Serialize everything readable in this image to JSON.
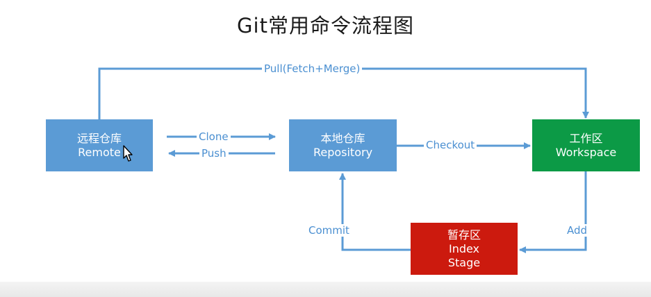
{
  "title": "Git常用命令流程图",
  "nodes": {
    "remote": {
      "line1": "远程仓库",
      "line2": "Remote",
      "color": "#5b9bd5"
    },
    "repository": {
      "line1": "本地仓库",
      "line2": "Repository",
      "color": "#5b9bd5"
    },
    "workspace": {
      "line1": "工作区",
      "line2": "Workspace",
      "color": "#0c9a46"
    },
    "index": {
      "line1": "暂存区",
      "line2": "Index",
      "line3": "Stage",
      "color": "#cc1a0e"
    }
  },
  "edges": {
    "pull": "Pull(Fetch+Merge)",
    "clone": "Clone",
    "push": "Push",
    "checkout": "Checkout",
    "commit": "Commit",
    "add": "Add"
  },
  "arrow_color": "#5b9bd5"
}
